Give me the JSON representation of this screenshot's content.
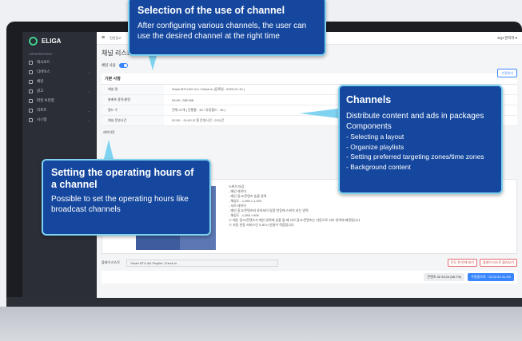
{
  "app": {
    "name": "ELIGA",
    "admin_label": "Advertisement"
  },
  "sidebar": {
    "items": [
      {
        "label": "대시보드",
        "has_chevron": false
      },
      {
        "label": "디바이스",
        "has_chevron": true
      },
      {
        "label": "채널",
        "has_chevron": false
      },
      {
        "label": "광고",
        "has_chevron": true
      },
      {
        "label": "파일 보관함",
        "has_chevron": false
      },
      {
        "label": "리포트",
        "has_chevron": true
      },
      {
        "label": "시스템",
        "has_chevron": true
      }
    ]
  },
  "topbar": {
    "menu_icon": "≡",
    "breadcrumb": "전판광고",
    "user": "SQI 관리자 ▾"
  },
  "page": {
    "title": "채널 리스트 > 채널 상세",
    "toggle_label": "채널 사용",
    "action_button": "수정하기",
    "section_basic": "기본 사항",
    "rows": [
      {
        "key": "채널 명",
        "value": "Smart BTU AD Cm. Check in (등록일 : 2020-01-10 )"
      },
      {
        "key": "총배포 용적/총량",
        "value": "09:00 / 382 MB"
      },
      {
        "key": "필드 수",
        "value": "전체 47개 | 진행즁 : 32 / 유휴필드 : 15 )"
      },
      {
        "key": "채널 운영시간",
        "value": "02:00 ~ 01:00  ☑ 종 운영시간 : 23시간"
      }
    ],
    "layout_section": "레이아웃",
    "layout_tags": [
      "ZA",
      "ZB"
    ],
    "layout_notes": [
      "스위치 마감",
      "- 메인 레이어",
      "- 메인 광고/콘텐츠 송출 영역",
      "- 해상도 : 1,080 x 1,920",
      "- 서브 레이어",
      "- 메인 광고/콘텐츠와 유하되어 일정 반응에 스위치 되는 영역",
      "- 해상도 : 1,080 x 906",
      "※ 메인 광고/콘텐츠가 메인 영역에 송출 될 때 서브 광고/콘텐츠는 자동으로 서브 영역에 배정됩니다.",
      "※ 자동 연동 서비스인 S-BTU 만들어 적합합니다."
    ],
    "playlist_label": "플레이 리스트",
    "playlist_value": "Smart BTU AD Playlist. Check in",
    "playlist_buttons": [
      "운도 한 안에 보기",
      "플레이 리스트 불러오기"
    ],
    "status_pills": [
      "콘텐츠 32  03:20 (58.7%)",
      "우용중으로 : 15  02:40  41.3%"
    ]
  },
  "callouts": {
    "channel_use": {
      "title": "Selection of the use of channel",
      "body": "After configuring various channels, the user can use the desired channel at the right time"
    },
    "channels": {
      "title": "Channels",
      "body": "Distribute content and ads in packages",
      "components_title": "Components",
      "items": [
        "- Selecting a layout",
        "- Organize playlists",
        "- Setting preferred targeting zones/time zones",
        "- Background content"
      ]
    },
    "hours": {
      "title": "Setting the operating hours of a channel",
      "body": "Possible to set the operating hours like broadcast channels"
    }
  },
  "colors": {
    "callout_bg": "#15479e",
    "callout_border": "#7fd3f0",
    "accent": "#3a86ff",
    "sidebar": "#2b2e36"
  }
}
